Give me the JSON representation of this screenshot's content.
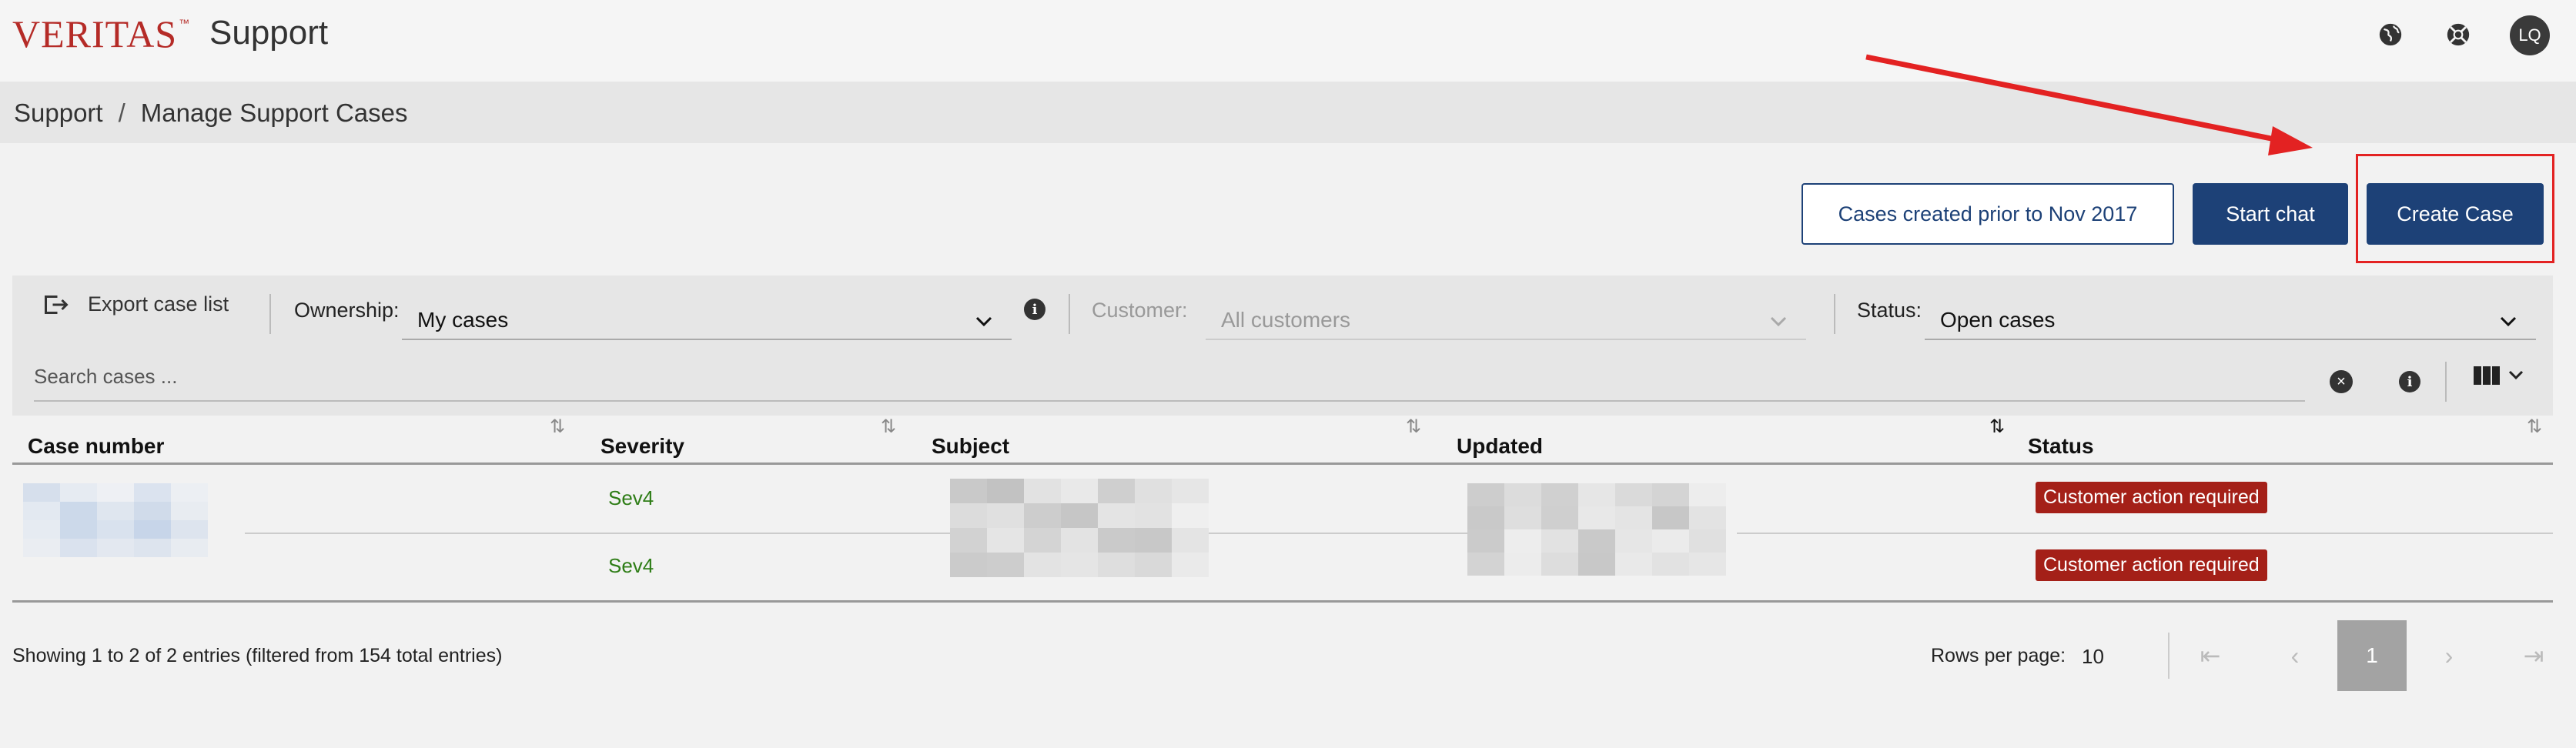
{
  "header": {
    "logo_text": "VERITAS",
    "logo_tm": "™",
    "app_title": "Support",
    "avatar_initials": "LQ"
  },
  "breadcrumb": {
    "items": [
      "Support",
      "Manage Support Cases"
    ],
    "separator": "/"
  },
  "actions": {
    "prior_cases_label": "Cases created prior to Nov 2017",
    "start_chat_label": "Start chat",
    "create_case_label": "Create Case"
  },
  "filters": {
    "export_label": "Export case list",
    "ownership_label": "Ownership:",
    "ownership_value": "My cases",
    "customer_label": "Customer:",
    "customer_value": "All customers",
    "status_label": "Status:",
    "status_value": "Open cases",
    "search_placeholder": "Search cases ..."
  },
  "table": {
    "columns": [
      "Case number",
      "Severity",
      "Subject",
      "Updated",
      "Status"
    ],
    "rows": [
      {
        "severity": "Sev4",
        "status": "Customer action required"
      },
      {
        "severity": "Sev4",
        "status": "Customer action required"
      }
    ]
  },
  "footer": {
    "showing_text": "Showing 1 to 2 of 2 entries (filtered from 154 total entries)",
    "rows_per_page_label": "Rows per page:",
    "rows_per_page_value": "10",
    "current_page": "1"
  },
  "colors": {
    "brand_red": "#b52b27",
    "primary_blue": "#1d4177",
    "status_badge": "#a42018",
    "severity_green": "#2e7d16",
    "annotation_red": "#e32222"
  }
}
